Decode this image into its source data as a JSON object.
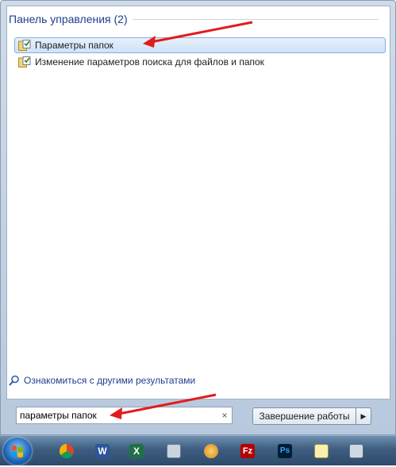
{
  "start_menu": {
    "group_title": "Панель управления (2)",
    "results": [
      {
        "label": "Параметры папок",
        "selected": true,
        "icon": "folder-options-icon"
      },
      {
        "label": "Изменение параметров поиска для файлов и папок",
        "selected": false,
        "icon": "folder-options-icon"
      }
    ],
    "more_results_label": "Ознакомиться с другими результатами",
    "search": {
      "value": "параметры папок",
      "clear_glyph": "×"
    },
    "shutdown_label": "Завершение работы",
    "shutdown_arrow": "▶"
  },
  "taskbar": {
    "items": [
      "start-orb",
      "chrome-icon",
      "word-icon",
      "excel-icon",
      "calculator-icon",
      "paint-icon",
      "filezilla-icon",
      "photoshop-icon",
      "notepad-icon",
      "remote-desktop-icon"
    ]
  },
  "colors": {
    "accent": "#1e3e8c",
    "arrow": "#e21b1b",
    "selection": "#cfe2f8"
  }
}
